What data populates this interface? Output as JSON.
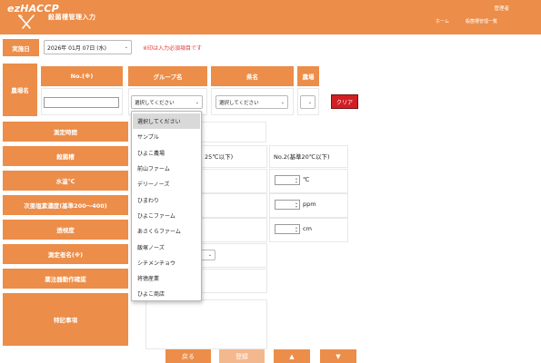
{
  "header": {
    "logo": "ezHACCP",
    "title": "殺菌槽管理入力",
    "admin": "管理者",
    "nav_home": "ホーム",
    "nav_list": "殺菌槽管理一覧"
  },
  "form": {
    "date_label": "実施日",
    "date_value": "2026年 01月 07日 (水)",
    "required_note": "※印は入力必須項目です",
    "place_label": "農場名",
    "col_no": "No.(※)",
    "col_group": "グループ名",
    "col_ken": "県名",
    "col_farm": "農場",
    "group_value": "選択してください",
    "ken_value": "選択してください",
    "farm_value": "",
    "clear_button": "クリア",
    "rows": {
      "time": "測定時間",
      "tank": "殺菌槽",
      "water_temp": "水温℃",
      "chlorine": "次亜塩素濃度(基準200～400)",
      "transparency": "透視度",
      "measurer": "測定者名(※)",
      "sprayer": "薬注器動作確認",
      "remarks": "特記事項"
    },
    "tank_no1_partial": "25℃以下)",
    "tank_no2": "No.2(基準20℃以下)",
    "unit_temp": "℃",
    "unit_ppm": "ppm",
    "unit_cm": "cm"
  },
  "dropdown": {
    "options": [
      "選択してください",
      "サンプル",
      "ひよこ農場",
      "前山ファーム",
      "デリーノーズ",
      "ひまわり",
      "ひよこファーム",
      "あさくらファーム",
      "飯塚ノーズ",
      "シチメンチョウ",
      "将徳産業",
      "ひよこ商店"
    ],
    "selected_index": 0
  },
  "footer": {
    "back": "戻る",
    "register": "登録",
    "up": "▲",
    "down": "▼"
  },
  "colors": {
    "accent": "#ec8d49",
    "danger": "#d11f24",
    "required": "#e23a3a"
  }
}
